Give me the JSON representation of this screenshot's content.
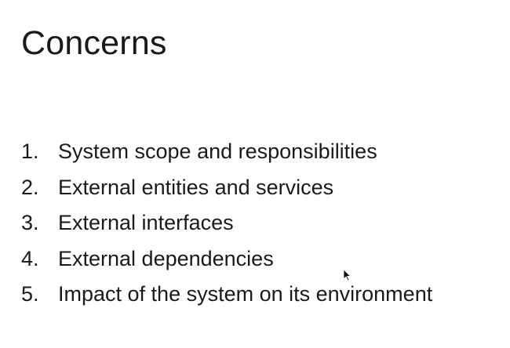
{
  "slide": {
    "title": "Concerns",
    "items": [
      {
        "number": "1.",
        "text": "System scope and responsibilities"
      },
      {
        "number": "2.",
        "text": "External entities and services"
      },
      {
        "number": "3.",
        "text": "External interfaces"
      },
      {
        "number": "4.",
        "text": "External dependencies"
      },
      {
        "number": "5.",
        "text": "Impact of the system on its environment"
      }
    ]
  },
  "colors": {
    "background": "#ffffff",
    "text": "#1a1a1a"
  },
  "icons": {
    "cursor": "mouse-pointer-icon"
  }
}
